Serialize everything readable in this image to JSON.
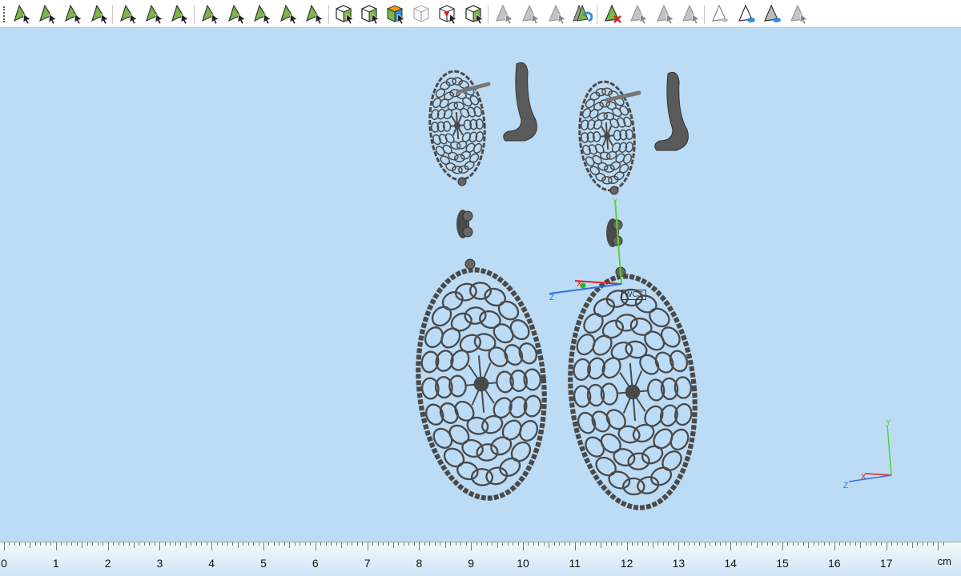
{
  "toolbar": {
    "icons": [
      {
        "name": "select-point-icon",
        "style": "green"
      },
      {
        "name": "select-face-icon",
        "style": "green"
      },
      {
        "name": "select-surface-icon",
        "style": "green"
      },
      {
        "name": "select-body-icon",
        "style": "green"
      },
      {
        "name": "planar-face-icon",
        "style": "green"
      },
      {
        "name": "blend-face-icon",
        "style": "green"
      },
      {
        "name": "curve-face-icon",
        "style": "green"
      },
      {
        "name": "mesh-faces-icon",
        "style": "green"
      },
      {
        "name": "split-faces-icon",
        "style": "green"
      },
      {
        "name": "star-faces-icon",
        "style": "green"
      },
      {
        "name": "wheel-faces-icon",
        "style": "green"
      },
      {
        "name": "ellipse-faces-icon",
        "style": "green"
      },
      {
        "name": "cube-select-icon",
        "style": "cube"
      },
      {
        "name": "cube-top-icon",
        "style": "cube"
      },
      {
        "name": "cube-color-icon",
        "style": "cubecolor"
      },
      {
        "name": "cube-ghost-icon",
        "style": "ghost"
      },
      {
        "name": "cube-inside-icon",
        "style": "cubered"
      },
      {
        "name": "cube-side-icon",
        "style": "cube"
      },
      {
        "name": "triangle-select-icon",
        "style": "gray"
      },
      {
        "name": "triangle-extrude-icon",
        "style": "gray"
      },
      {
        "name": "triangle-arrow-icon",
        "style": "gray"
      },
      {
        "name": "triangle-refresh-icon",
        "style": "greenblue"
      },
      {
        "name": "triangle-delete-icon",
        "style": "greenred"
      },
      {
        "name": "triangle-split-icon",
        "style": "gray"
      },
      {
        "name": "triangle-copy-icon",
        "style": "gray"
      },
      {
        "name": "triangle-flat-icon",
        "style": "gray"
      },
      {
        "name": "triangle-view-icon",
        "style": "outline"
      },
      {
        "name": "triangle-sync-view-icon",
        "style": "outlineblue"
      },
      {
        "name": "triangle-dark-view-icon",
        "style": "outlineblue"
      },
      {
        "name": "triangle-hide-icon",
        "style": "gray"
      }
    ]
  },
  "viewport": {
    "wcs_label": "WCS",
    "gizmo": {
      "x": "X",
      "y": "Y",
      "z": "Z"
    },
    "triad": {
      "x": "X",
      "y": "Y",
      "z": "Z"
    },
    "colors": {
      "x": "#e02020",
      "y": "#5ad030",
      "z": "#3070e0",
      "part": "#4a4a4a"
    }
  },
  "ruler": {
    "unit": "cm",
    "labels": [
      "0",
      "1",
      "2",
      "3",
      "4",
      "5",
      "6",
      "7",
      "8",
      "9",
      "10",
      "11",
      "12",
      "13",
      "14",
      "15",
      "16",
      "17"
    ]
  }
}
